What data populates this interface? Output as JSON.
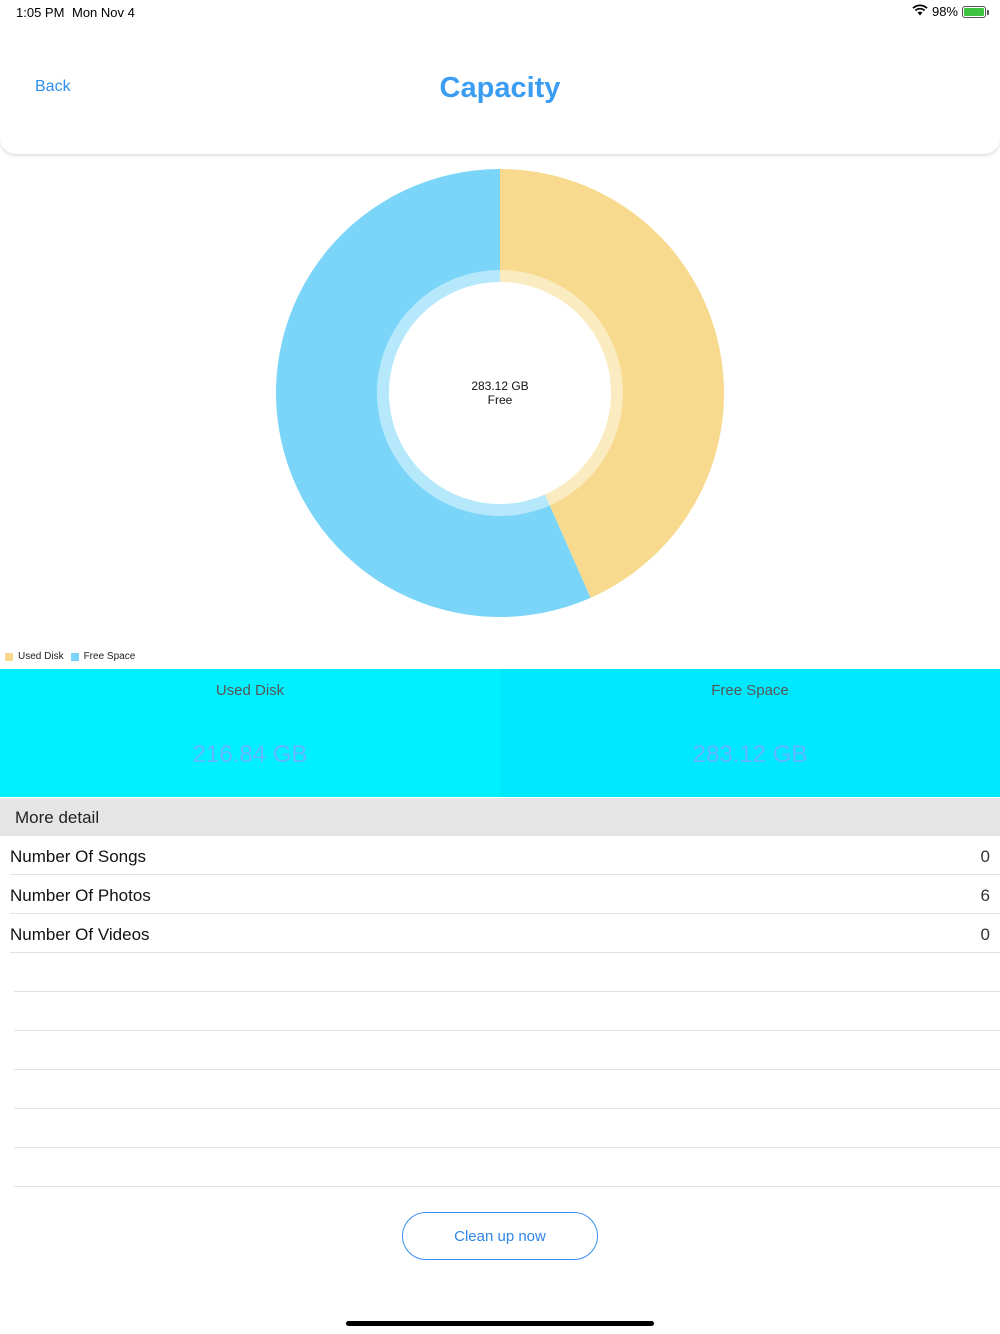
{
  "status_bar": {
    "time": "1:05 PM",
    "date": "Mon Nov 4",
    "battery_percent": "98%",
    "battery_level": 0.98,
    "icons": [
      "wifi-icon",
      "battery-icon"
    ]
  },
  "header": {
    "back_label": "Back",
    "title": "Capacity"
  },
  "chart_data": {
    "type": "pie",
    "donut": true,
    "categories": [
      "Used Disk",
      "Free Space"
    ],
    "values": [
      216.84,
      283.12
    ],
    "units": "GB",
    "colors": [
      "#f8da8e",
      "#7bd5f8"
    ],
    "center_label_value": "283.12 GB",
    "center_label_caption": "Free",
    "legend_placement": "bottom-left"
  },
  "legend": {
    "items": [
      {
        "label": "Used Disk",
        "color": "#f8da8e"
      },
      {
        "label": "Free Space",
        "color": "#7bd5f8"
      }
    ]
  },
  "summary": {
    "used": {
      "label": "Used Disk",
      "value": "216.84 GB",
      "color": "#00f0ff"
    },
    "free": {
      "label": "Free Space",
      "value": "283.12 GB",
      "color": "#00e8fd"
    }
  },
  "details": {
    "title": "More detail",
    "rows": [
      {
        "label": "Number Of Songs",
        "value": "0"
      },
      {
        "label": "Number Of Photos",
        "value": "6"
      },
      {
        "label": "Number Of Videos",
        "value": "0"
      }
    ]
  },
  "action": {
    "clean_label": "Clean up now"
  }
}
